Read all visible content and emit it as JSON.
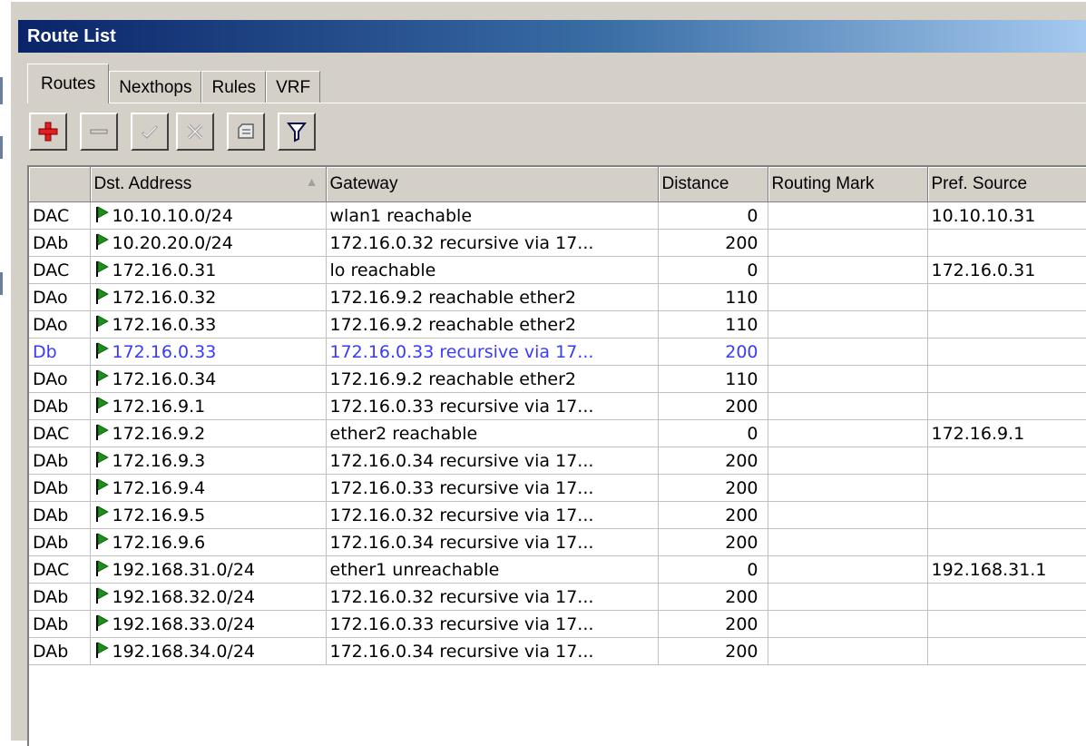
{
  "window": {
    "title": "Route List"
  },
  "tabs": [
    {
      "label": "Routes",
      "active": true
    },
    {
      "label": "Nexthops",
      "active": false
    },
    {
      "label": "Rules",
      "active": false
    },
    {
      "label": "VRF",
      "active": false
    }
  ],
  "toolbar": {
    "buttons": [
      {
        "name": "add",
        "icon": "plus-icon",
        "color": "#e02020"
      },
      {
        "name": "remove",
        "icon": "minus-icon"
      },
      {
        "name": "enable",
        "icon": "check-icon"
      },
      {
        "name": "disable",
        "icon": "cross-icon"
      },
      {
        "name": "comment",
        "icon": "comment-icon"
      },
      {
        "name": "filter",
        "icon": "filter-icon"
      }
    ]
  },
  "table": {
    "columns": [
      "",
      "Dst. Address",
      "Gateway",
      "Distance",
      "Routing Mark",
      "Pref. Source"
    ],
    "sort_column": "Dst. Address",
    "rows": [
      {
        "flags": "DAC",
        "dst": "10.10.10.0/24",
        "gateway": "wlan1 reachable",
        "distance": "0",
        "mark": "",
        "pref": "10.10.10.31",
        "inactive": false
      },
      {
        "flags": "DAb",
        "dst": "10.20.20.0/24",
        "gateway": "172.16.0.32 recursive via 17...",
        "distance": "200",
        "mark": "",
        "pref": "",
        "inactive": false
      },
      {
        "flags": "DAC",
        "dst": "172.16.0.31",
        "gateway": "lo reachable",
        "distance": "0",
        "mark": "",
        "pref": "172.16.0.31",
        "inactive": false
      },
      {
        "flags": "DAo",
        "dst": "172.16.0.32",
        "gateway": "172.16.9.2 reachable ether2",
        "distance": "110",
        "mark": "",
        "pref": "",
        "inactive": false
      },
      {
        "flags": "DAo",
        "dst": "172.16.0.33",
        "gateway": "172.16.9.2 reachable ether2",
        "distance": "110",
        "mark": "",
        "pref": "",
        "inactive": false
      },
      {
        "flags": "Db",
        "dst": "172.16.0.33",
        "gateway": "172.16.0.33 recursive via 17...",
        "distance": "200",
        "mark": "",
        "pref": "",
        "inactive": true
      },
      {
        "flags": "DAo",
        "dst": "172.16.0.34",
        "gateway": "172.16.9.2 reachable ether2",
        "distance": "110",
        "mark": "",
        "pref": "",
        "inactive": false
      },
      {
        "flags": "DAb",
        "dst": "172.16.9.1",
        "gateway": "172.16.0.33 recursive via 17...",
        "distance": "200",
        "mark": "",
        "pref": "",
        "inactive": false
      },
      {
        "flags": "DAC",
        "dst": "172.16.9.2",
        "gateway": "ether2 reachable",
        "distance": "0",
        "mark": "",
        "pref": "172.16.9.1",
        "inactive": false
      },
      {
        "flags": "DAb",
        "dst": "172.16.9.3",
        "gateway": "172.16.0.34 recursive via 17...",
        "distance": "200",
        "mark": "",
        "pref": "",
        "inactive": false
      },
      {
        "flags": "DAb",
        "dst": "172.16.9.4",
        "gateway": "172.16.0.33 recursive via 17...",
        "distance": "200",
        "mark": "",
        "pref": "",
        "inactive": false
      },
      {
        "flags": "DAb",
        "dst": "172.16.9.5",
        "gateway": "172.16.0.32 recursive via 17...",
        "distance": "200",
        "mark": "",
        "pref": "",
        "inactive": false
      },
      {
        "flags": "DAb",
        "dst": "172.16.9.6",
        "gateway": "172.16.0.34 recursive via 17...",
        "distance": "200",
        "mark": "",
        "pref": "",
        "inactive": false
      },
      {
        "flags": "DAC",
        "dst": "192.168.31.0/24",
        "gateway": "ether1 unreachable",
        "distance": "0",
        "mark": "",
        "pref": "192.168.31.1",
        "inactive": false
      },
      {
        "flags": "DAb",
        "dst": "192.168.32.0/24",
        "gateway": "172.16.0.32 recursive via 17...",
        "distance": "200",
        "mark": "",
        "pref": "",
        "inactive": false
      },
      {
        "flags": "DAb",
        "dst": "192.168.33.0/24",
        "gateway": "172.16.0.33 recursive via 17...",
        "distance": "200",
        "mark": "",
        "pref": "",
        "inactive": false
      },
      {
        "flags": "DAb",
        "dst": "192.168.34.0/24",
        "gateway": "172.16.0.34 recursive via 17...",
        "distance": "200",
        "mark": "",
        "pref": "",
        "inactive": false
      }
    ]
  },
  "colors": {
    "inactive_text": "#3a3aff",
    "flag_icon": "#1a8f1a"
  }
}
